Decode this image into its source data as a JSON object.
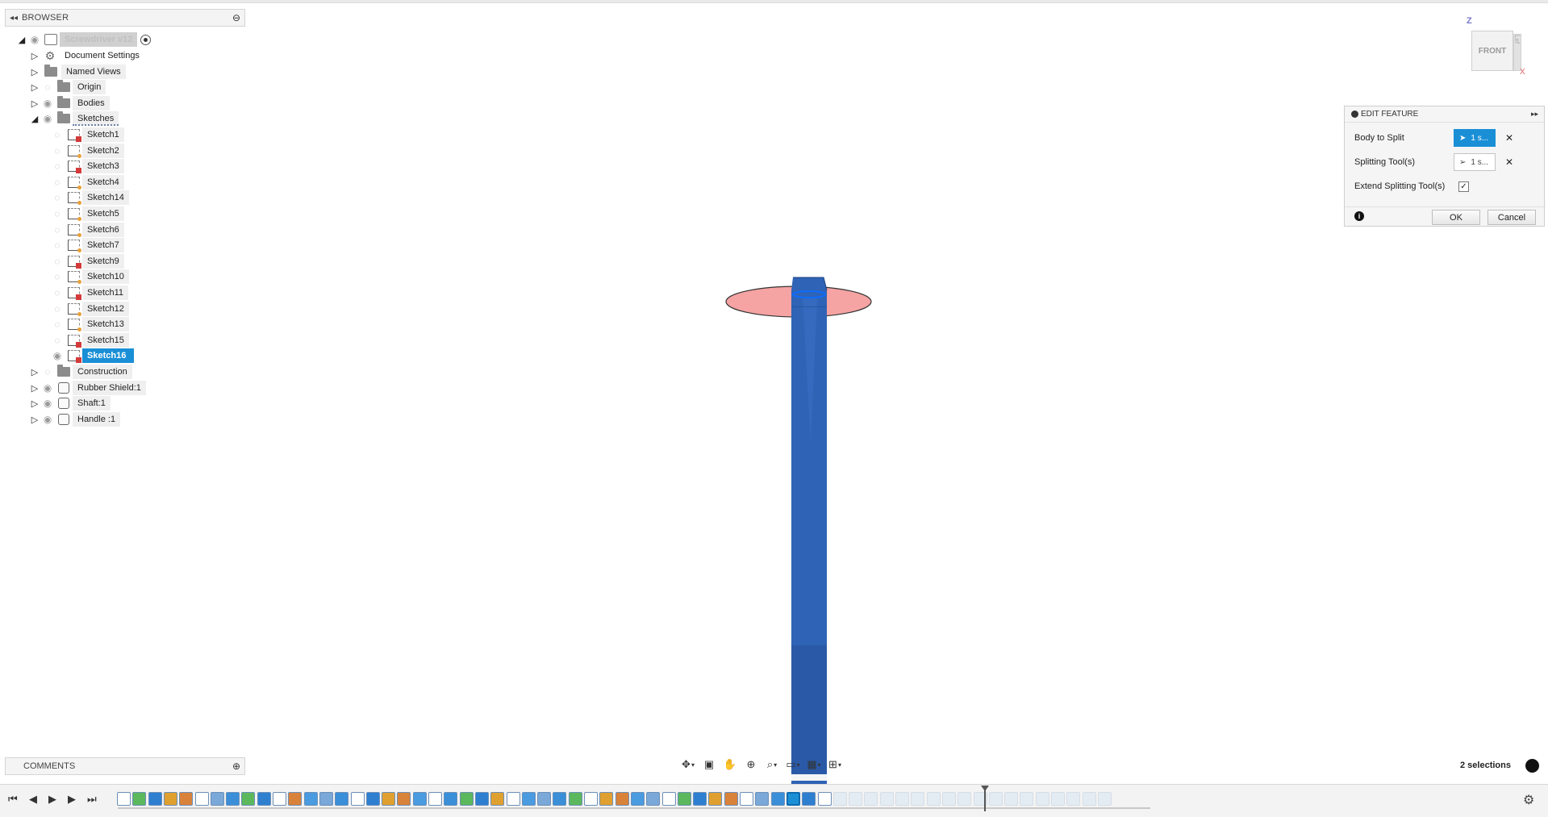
{
  "browser": {
    "title": "BROWSER",
    "root_label": "Screwdriver v12",
    "items": [
      {
        "label": "Document Settings"
      },
      {
        "label": "Named Views"
      },
      {
        "label": "Origin"
      },
      {
        "label": "Bodies"
      },
      {
        "label": "Sketches"
      },
      {
        "label": "Construction"
      },
      {
        "label": "Rubber Shield:1"
      },
      {
        "label": "Shaft:1"
      },
      {
        "label": "Handle :1"
      }
    ],
    "sketches": [
      {
        "label": "Sketch1",
        "marker": "red"
      },
      {
        "label": "Sketch2",
        "marker": "orange"
      },
      {
        "label": "Sketch3",
        "marker": "red"
      },
      {
        "label": "Sketch4",
        "marker": "orange"
      },
      {
        "label": "Sketch14",
        "marker": "orange"
      },
      {
        "label": "Sketch5",
        "marker": "orange"
      },
      {
        "label": "Sketch6",
        "marker": "orange"
      },
      {
        "label": "Sketch7",
        "marker": "orange"
      },
      {
        "label": "Sketch9",
        "marker": "red"
      },
      {
        "label": "Sketch10",
        "marker": "orange"
      },
      {
        "label": "Sketch11",
        "marker": "red"
      },
      {
        "label": "Sketch12",
        "marker": "orange"
      },
      {
        "label": "Sketch13",
        "marker": "orange"
      },
      {
        "label": "Sketch15",
        "marker": "red"
      },
      {
        "label": "Sketch16",
        "marker": "red",
        "selected": true
      }
    ]
  },
  "comments": {
    "title": "COMMENTS"
  },
  "viewcube": {
    "face": "FRONT",
    "side": "Lef",
    "axis_z": "Z",
    "axis_x": "X"
  },
  "edit_feature": {
    "title": "EDIT FEATURE",
    "body_to_split_label": "Body to Split",
    "body_to_split_value": "1 s...",
    "splitting_tool_label": "Splitting Tool(s)",
    "splitting_tool_value": "1 s...",
    "extend_label": "Extend Splitting Tool(s)",
    "extend_checked": true,
    "ok_label": "OK",
    "cancel_label": "Cancel"
  },
  "status": {
    "selections": "2 selections"
  },
  "colors": {
    "accent": "#1a8fd6",
    "body": "#2f63b5",
    "plane": "#f4a0a0"
  }
}
